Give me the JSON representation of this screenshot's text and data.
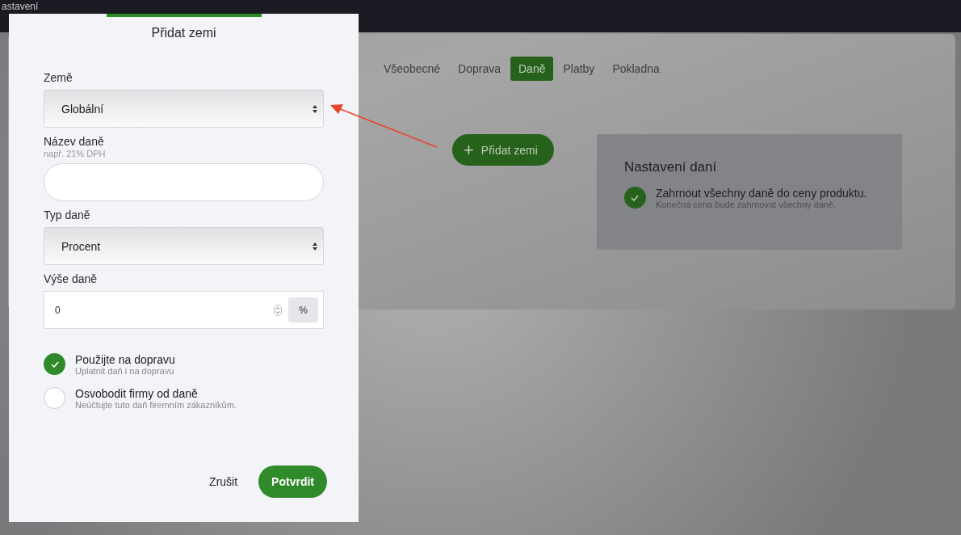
{
  "page_title": "astavení",
  "tabs": [
    {
      "label": "Všeobecné",
      "selected": false
    },
    {
      "label": "Doprava",
      "selected": false
    },
    {
      "label": "Daně",
      "selected": true
    },
    {
      "label": "Platby",
      "selected": false
    },
    {
      "label": "Pokladna",
      "selected": false
    }
  ],
  "add_button": {
    "icon": "+",
    "label": "Přidat zemi"
  },
  "tax_settings": {
    "title": "Nastavení daní",
    "option": {
      "label": "Zahrnout všechny daně do ceny produktu.",
      "hint": "Konečná cena bude zahrnovat všechny daně.",
      "checked": true
    }
  },
  "dialog": {
    "title": "Přidat zemi",
    "fields": [
      {
        "kind": "select",
        "label": "Země",
        "value": "Globální"
      },
      {
        "kind": "text",
        "label": "Název daně",
        "hint": "např. 21% DPH"
      },
      {
        "kind": "select",
        "label": "Typ daně",
        "value": "Procent"
      },
      {
        "kind": "number",
        "label": "Výše daně",
        "value": "0",
        "unit": "%"
      }
    ],
    "options": [
      {
        "label": "Použijte na dopravu",
        "hint": "Uplatnit daň i na dopravu",
        "checked": true
      },
      {
        "label": "Osvobodit firmy od daně",
        "hint": "Neúčtujte tuto daň firemním zákazníkům.",
        "checked": false
      }
    ],
    "cancel": "Zrušit",
    "confirm": "Potvrdit"
  }
}
